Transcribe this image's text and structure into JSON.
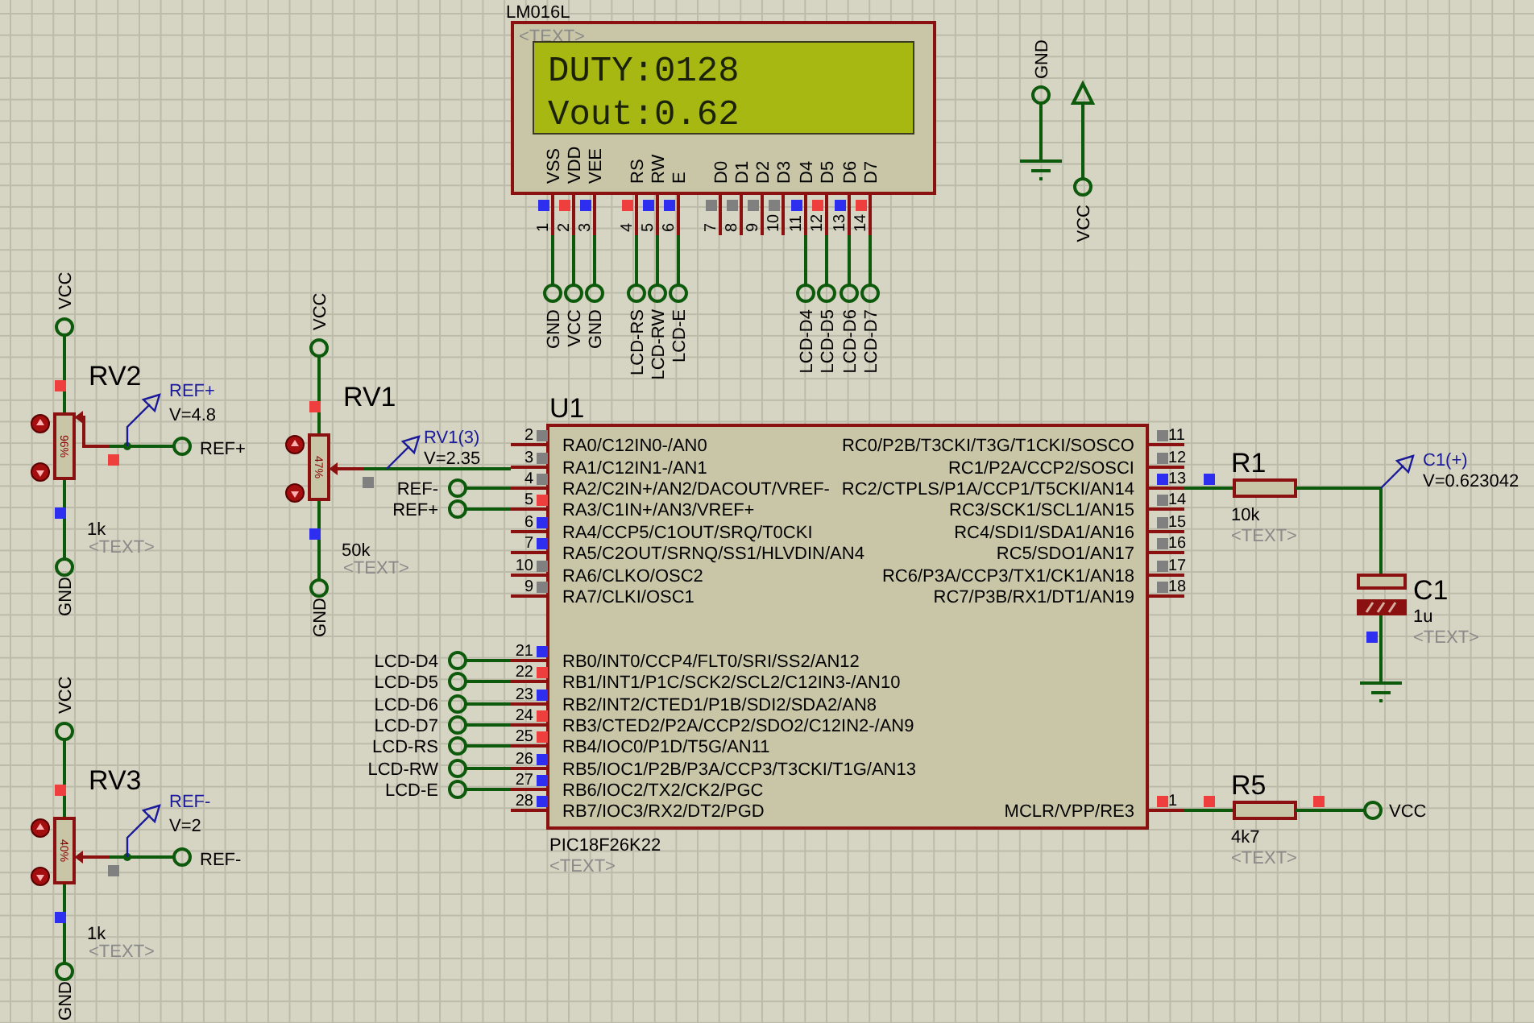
{
  "lcd": {
    "part": "LM016L",
    "text_tag": "<TEXT>",
    "lines": [
      "DUTY:0128",
      "Vout:0.62"
    ],
    "pins": [
      {
        "label": "VSS",
        "number": "1",
        "color": "#2e2ef0",
        "net": "GND"
      },
      {
        "label": "VDD",
        "number": "2",
        "color": "#ee3e3e",
        "net": "VCC"
      },
      {
        "label": "VEE",
        "number": "3",
        "color": "#2e2ef0",
        "net": "GND"
      },
      {
        "label": "RS",
        "number": "4",
        "color": "#ee3e3e",
        "net": "LCD-RS"
      },
      {
        "label": "RW",
        "number": "5",
        "color": "#2e2ef0",
        "net": "LCD-RW"
      },
      {
        "label": "E",
        "number": "6",
        "color": "#2e2ef0",
        "net": "LCD-E"
      },
      {
        "label": "D0",
        "number": "7",
        "color": "#808080"
      },
      {
        "label": "D1",
        "number": "8",
        "color": "#808080"
      },
      {
        "label": "D2",
        "number": "9",
        "color": "#808080"
      },
      {
        "label": "D3",
        "number": "10",
        "color": "#808080"
      },
      {
        "label": "D4",
        "number": "11",
        "color": "#2e2ef0",
        "net": "LCD-D4"
      },
      {
        "label": "D5",
        "number": "12",
        "color": "#ee3e3e",
        "net": "LCD-D5"
      },
      {
        "label": "D6",
        "number": "13",
        "color": "#2e2ef0",
        "net": "LCD-D6"
      },
      {
        "label": "D7",
        "number": "14",
        "color": "#ee3e3e",
        "net": "LCD-D7"
      }
    ]
  },
  "power_terminals": [
    {
      "kind": "ground",
      "label": "GND"
    },
    {
      "kind": "power",
      "label": "VCC"
    }
  ],
  "potentiometers": [
    {
      "name": "RV2",
      "value": "1k",
      "text_tag": "<TEXT>",
      "setting": "96%",
      "level": 0.96,
      "pins": [
        {
          "net": "VCC",
          "color": "#ee3e3e"
        },
        {
          "net": "GND",
          "color": "#2e2ef0"
        }
      ],
      "wiper": {
        "color": "#ee3e3e"
      },
      "probe": {
        "name": "REF+",
        "reading": "V=4.8"
      },
      "net": "REF+"
    },
    {
      "name": "RV1",
      "value": "50k",
      "text_tag": "<TEXT>",
      "setting": "47%",
      "level": 0.47,
      "pins": [
        {
          "net": "VCC",
          "color": "#ee3e3e"
        },
        {
          "net": "GND",
          "color": "#2e2ef0"
        }
      ],
      "wiper": {
        "color": "#808080"
      },
      "probe": {
        "name": "RV1(3)",
        "reading": "V=2.35"
      }
    },
    {
      "name": "RV3",
      "value": "1k",
      "text_tag": "<TEXT>",
      "setting": "40%",
      "level": 0.4,
      "pins": [
        {
          "net": "VCC",
          "color": "#ee3e3e"
        },
        {
          "net": "GND",
          "color": "#2e2ef0"
        }
      ],
      "wiper": {
        "color": "#808080"
      },
      "probe": {
        "name": "REF-",
        "reading": "V=2"
      },
      "net": "REF-"
    }
  ],
  "mcu": {
    "name": "U1",
    "part": "PIC18F26K22",
    "text_tag": "<TEXT>",
    "left_pins": [
      {
        "number": "2",
        "label": "RA0/C12IN0-/AN0",
        "color": "#808080"
      },
      {
        "number": "3",
        "label": "RA1/C12IN1-/AN1",
        "color": "#808080"
      },
      {
        "number": "4",
        "label": "RA2/C2IN+/AN2/DACOUT/VREF-",
        "color": "#808080",
        "net": "REF-"
      },
      {
        "number": "5",
        "label": "RA3/C1IN+/AN3/VREF+",
        "color": "#ee3e3e",
        "net": "REF+"
      },
      {
        "number": "6",
        "label": "RA4/CCP5/C1OUT/SRQ/T0CKI",
        "color": "#2e2ef0"
      },
      {
        "number": "7",
        "label": "RA5/C2OUT/SRNQ/SS1/HLVDIN/AN4",
        "color": "#2e2ef0"
      },
      {
        "number": "10",
        "label": "RA6/CLKO/OSC2",
        "color": "#808080"
      },
      {
        "number": "9",
        "label": "RA7/CLKI/OSC1",
        "color": "#808080"
      },
      {
        "number": "21",
        "label": "RB0/INT0/CCP4/FLT0/SRI/SS2/AN12",
        "color": "#2e2ef0",
        "net": "LCD-D4"
      },
      {
        "number": "22",
        "label": "RB1/INT1/P1C/SCK2/SCL2/C12IN3-/AN10",
        "color": "#ee3e3e",
        "net": "LCD-D5"
      },
      {
        "number": "23",
        "label": "RB2/INT2/CTED1/P1B/SDI2/SDA2/AN8",
        "color": "#2e2ef0",
        "net": "LCD-D6"
      },
      {
        "number": "24",
        "label": "RB3/CTED2/P2A/CCP2/SDO2/C12IN2-/AN9",
        "color": "#ee3e3e",
        "net": "LCD-D7"
      },
      {
        "number": "25",
        "label": "RB4/IOC0/P1D/T5G/AN11",
        "color": "#ee3e3e",
        "net": "LCD-RS"
      },
      {
        "number": "26",
        "label": "RB5/IOC1/P2B/P3A/CCP3/T3CKI/T1G/AN13",
        "color": "#2e2ef0",
        "net": "LCD-RW"
      },
      {
        "number": "27",
        "label": "RB6/IOC2/TX2/CK2/PGC",
        "color": "#2e2ef0",
        "net": "LCD-E"
      },
      {
        "number": "28",
        "label": "RB7/IOC3/RX2/DT2/PGD",
        "color": "#2e2ef0"
      }
    ],
    "right_pins": [
      {
        "number": "11",
        "label": "RC0/P2B/T3CKI/T3G/T1CKI/SOSCO",
        "color": "#808080"
      },
      {
        "number": "12",
        "label": "RC1/P2A/CCP2/SOSCI",
        "color": "#808080"
      },
      {
        "number": "13",
        "label": "RC2/CTPLS/P1A/CCP1/T5CKI/AN14",
        "color": "#2e2ef0"
      },
      {
        "number": "14",
        "label": "RC3/SCK1/SCL1/AN15",
        "color": "#808080"
      },
      {
        "number": "15",
        "label": "RC4/SDI1/SDA1/AN16",
        "color": "#808080"
      },
      {
        "number": "16",
        "label": "RC5/SDO1/AN17",
        "color": "#808080"
      },
      {
        "number": "17",
        "label": "RC6/P3A/CCP3/TX1/CK1/AN18",
        "color": "#808080"
      },
      {
        "number": "18",
        "label": "RC7/P3B/RX1/DT1/AN19",
        "color": "#808080"
      },
      {
        "number": "1",
        "label": "MCLR/VPP/RE3",
        "color": "#ee3e3e"
      }
    ]
  },
  "resistors": [
    {
      "name": "R1",
      "value": "10k",
      "text_tag": "<TEXT>",
      "pins": [
        {
          "color": "#2e2ef0"
        }
      ]
    },
    {
      "name": "R5",
      "value": "4k7",
      "text_tag": "<TEXT>",
      "pins": [
        {
          "color": "#ee3e3e"
        },
        {
          "color": "#ee3e3e"
        }
      ],
      "net": "VCC"
    }
  ],
  "capacitor": {
    "name": "C1",
    "value": "1u",
    "text_tag": "<TEXT>",
    "pin": {
      "color": "#2e2ef0"
    },
    "probe": {
      "name": "C1(+)",
      "reading": "V=0.623042"
    }
  }
}
